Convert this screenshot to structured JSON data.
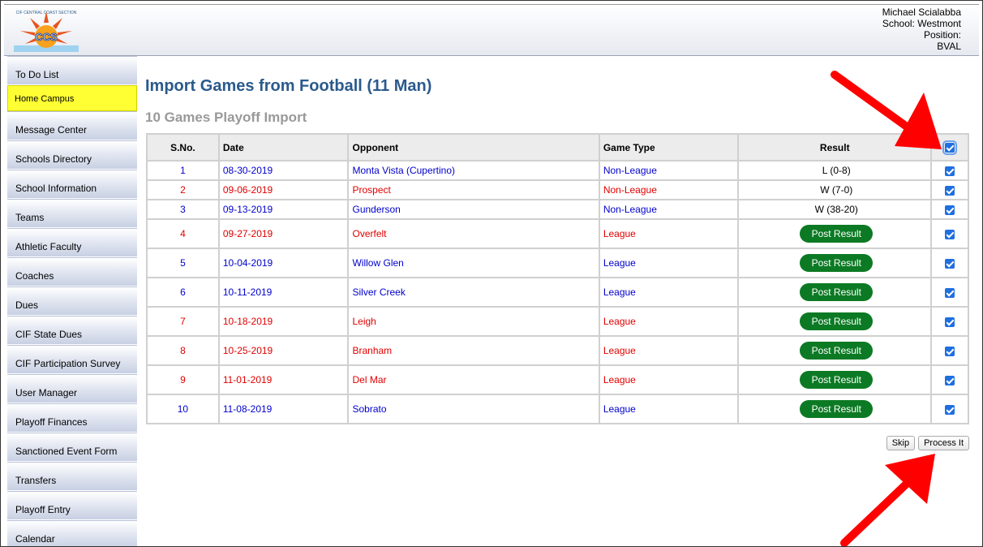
{
  "header": {
    "logo_text": "CCS",
    "logo_ring_text": "CIF CENTRAL COAST SECTION",
    "user_name": "Michael Scialabba",
    "school": "School: Westmont",
    "position_label": "Position:",
    "position_value": "BVAL"
  },
  "sidebar": {
    "items": [
      {
        "label": "To Do List"
      },
      {
        "label": "Home Campus"
      },
      {
        "label": "Message Center"
      },
      {
        "label": "Schools Directory"
      },
      {
        "label": "School Information"
      },
      {
        "label": "Teams"
      },
      {
        "label": "Athletic Faculty"
      },
      {
        "label": "Coaches"
      },
      {
        "label": "Dues"
      },
      {
        "label": "CIF State Dues"
      },
      {
        "label": "CIF Participation Survey"
      },
      {
        "label": "User Manager"
      },
      {
        "label": "Playoff Finances"
      },
      {
        "label": "Sanctioned Event Form"
      },
      {
        "label": "Transfers"
      },
      {
        "label": "Playoff Entry"
      },
      {
        "label": "Calendar"
      }
    ]
  },
  "main": {
    "title": "Import Games from Football (11 Man)",
    "subtitle": "10 Games Playoff Import",
    "columns": {
      "sno": "S.No.",
      "date": "Date",
      "opponent": "Opponent",
      "game_type": "Game Type",
      "result": "Result"
    },
    "post_result_label": "Post Result",
    "rows": [
      {
        "sno": "1",
        "date": "08-30-2019",
        "opponent": "Monta Vista (Cupertino)",
        "type": "Non-League",
        "result": "L (0-8)"
      },
      {
        "sno": "2",
        "date": "09-06-2019",
        "opponent": "Prospect",
        "type": "Non-League",
        "result": "W (7-0)"
      },
      {
        "sno": "3",
        "date": "09-13-2019",
        "opponent": "Gunderson",
        "type": "Non-League",
        "result": "W (38-20)"
      },
      {
        "sno": "4",
        "date": "09-27-2019",
        "opponent": "Overfelt",
        "type": "League",
        "result": ""
      },
      {
        "sno": "5",
        "date": "10-04-2019",
        "opponent": "Willow Glen",
        "type": "League",
        "result": ""
      },
      {
        "sno": "6",
        "date": "10-11-2019",
        "opponent": "Silver Creek",
        "type": "League",
        "result": ""
      },
      {
        "sno": "7",
        "date": "10-18-2019",
        "opponent": "Leigh",
        "type": "League",
        "result": ""
      },
      {
        "sno": "8",
        "date": "10-25-2019",
        "opponent": "Branham",
        "type": "League",
        "result": ""
      },
      {
        "sno": "9",
        "date": "11-01-2019",
        "opponent": "Del Mar",
        "type": "League",
        "result": ""
      },
      {
        "sno": "10",
        "date": "11-08-2019",
        "opponent": "Sobrato",
        "type": "League",
        "result": ""
      }
    ],
    "skip_label": "Skip",
    "process_label": "Process It"
  },
  "colors": {
    "title_blue": "#2a5a8c",
    "row_blue": "#0000cc",
    "row_red": "#e00000",
    "post_green": "#0c7a24",
    "highlight_yellow": "#ffff33",
    "arrow_red": "#ff0000"
  }
}
